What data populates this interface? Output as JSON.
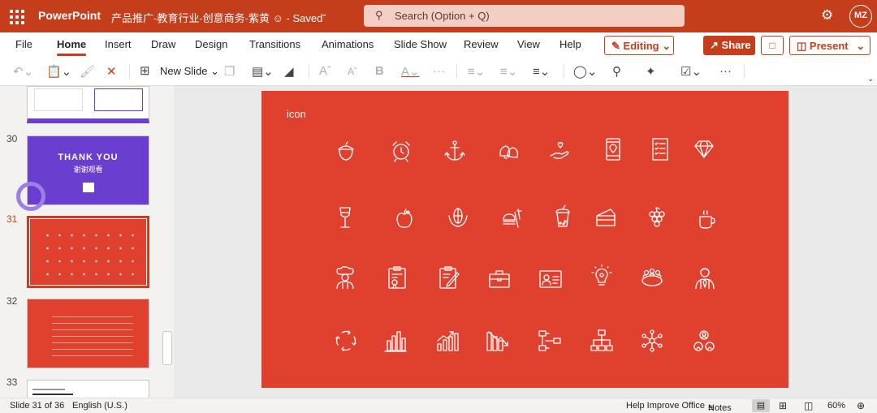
{
  "app": {
    "name": "PowerPoint",
    "doc_title": "产品推广-教育行业-创意商务-紫黄",
    "saved": "Saved",
    "avatar": "MZ"
  },
  "search": {
    "placeholder": "Search (Option + Q)"
  },
  "tabs": [
    "File",
    "Home",
    "Insert",
    "Draw",
    "Design",
    "Transitions",
    "Animations",
    "Slide Show",
    "Review",
    "View",
    "Help"
  ],
  "actions": {
    "editing": "Editing",
    "share": "Share",
    "present": "Present"
  },
  "toolbar": {
    "new_slide": "New Slide"
  },
  "thumbnails": [
    {
      "num": "30",
      "text1": "THANK YOU",
      "text2": "谢谢观看"
    },
    {
      "num": "31"
    },
    {
      "num": "32"
    },
    {
      "num": "33"
    }
  ],
  "slide": {
    "title": "icon",
    "icons": [
      [
        "acorn-icon",
        "alarm-clock-icon",
        "anchor-icon",
        "bells-icon",
        "hand-heart-icon",
        "phone-location-icon",
        "checklist-icon",
        "diamond-icon"
      ],
      [
        "wine-glass-icon",
        "apple-icon",
        "corn-icon",
        "fast-food-icon",
        "bubble-tea-icon",
        "cake-icon",
        "grapes-icon",
        "coffee-cup-icon"
      ],
      [
        "chef-icon",
        "clipboard-badge-icon",
        "clipboard-edit-icon",
        "briefcase-icon",
        "id-card-icon",
        "idea-bulb-icon",
        "meeting-table-icon",
        "businessman-icon"
      ],
      [
        "cycle-arrows-icon",
        "bar-chart-icon",
        "growth-chart-icon",
        "decline-chart-icon",
        "flowchart-icon",
        "org-chart-icon",
        "network-icon",
        "team-icon"
      ]
    ]
  },
  "status": {
    "slide_info": "Slide 31 of 36",
    "language": "English (U.S.)",
    "help": "Help Improve Office",
    "notes": "Notes",
    "zoom": "60%"
  },
  "colors": {
    "accent": "#c43e1c",
    "slide_bg": "#e0402e",
    "thumb_purple": "#6a3fd0"
  }
}
